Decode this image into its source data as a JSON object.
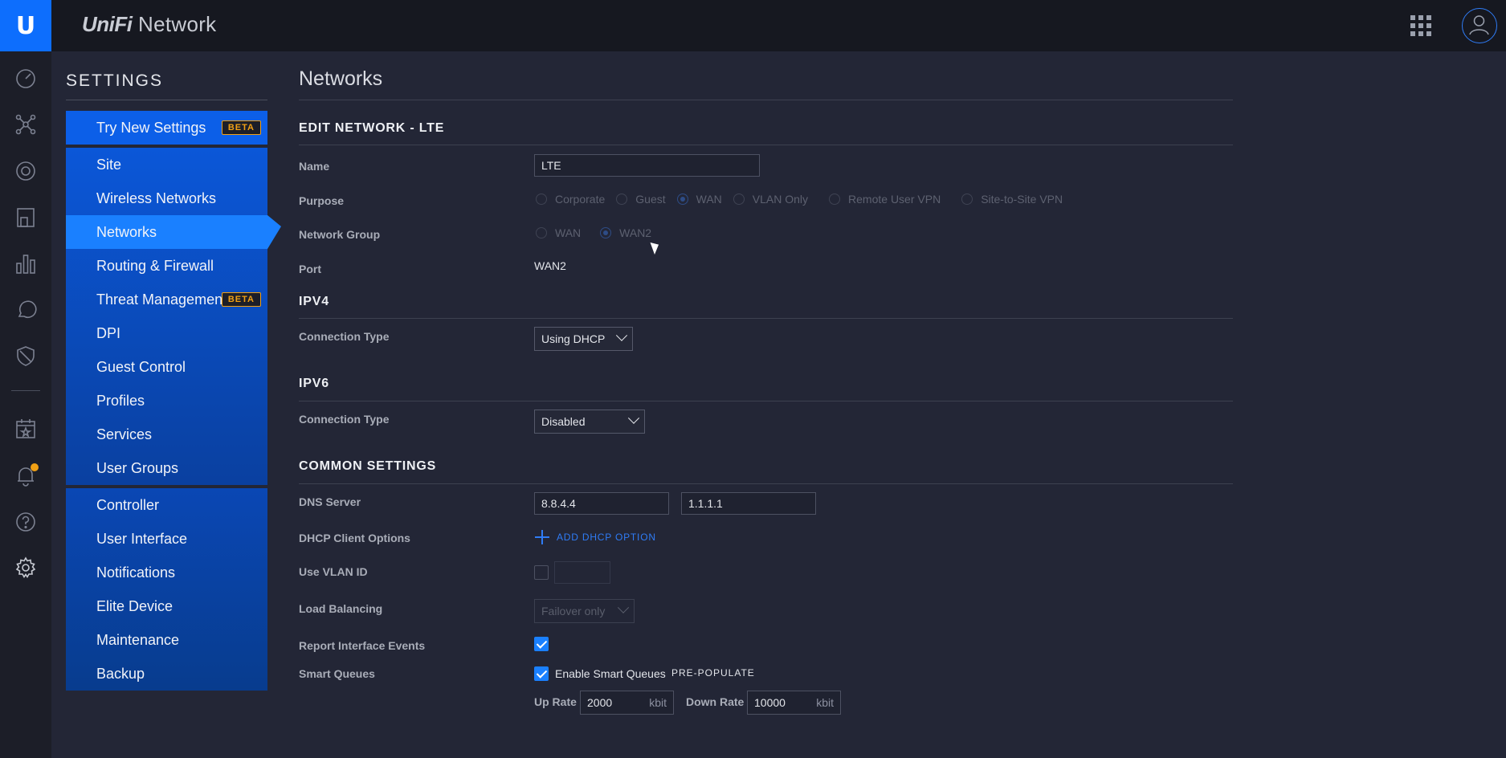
{
  "app": {
    "brand_uni": "UniFi",
    "brand_rest": "Network",
    "logo_letter": "U"
  },
  "settings": {
    "title": "SETTINGS",
    "items": [
      {
        "label": "Try New Settings",
        "badge": "BETA"
      },
      {
        "label": "Site"
      },
      {
        "label": "Wireless Networks"
      },
      {
        "label": "Networks",
        "active": true
      },
      {
        "label": "Routing & Firewall"
      },
      {
        "label": "Threat Management",
        "badge": "BETA"
      },
      {
        "label": "DPI"
      },
      {
        "label": "Guest Control"
      },
      {
        "label": "Profiles"
      },
      {
        "label": "Services"
      },
      {
        "label": "User Groups"
      },
      {
        "label": "Controller"
      },
      {
        "label": "User Interface"
      },
      {
        "label": "Notifications"
      },
      {
        "label": "Elite Device"
      },
      {
        "label": "Maintenance"
      },
      {
        "label": "Backup"
      }
    ]
  },
  "page": {
    "title": "Networks"
  },
  "edit": {
    "section_title": "EDIT NETWORK - LTE",
    "name_label": "Name",
    "name_value": "LTE",
    "purpose_label": "Purpose",
    "purpose_options": [
      "Corporate",
      "Guest",
      "WAN",
      "VLAN Only",
      "Remote User VPN",
      "Site-to-Site VPN"
    ],
    "purpose_selected": "WAN",
    "group_label": "Network Group",
    "group_options": [
      "WAN",
      "WAN2"
    ],
    "group_selected": "WAN2",
    "port_label": "Port",
    "port_value": "WAN2"
  },
  "ipv4": {
    "title": "IPV4",
    "conn_label": "Connection Type",
    "conn_value": "Using DHCP"
  },
  "ipv6": {
    "title": "IPV6",
    "conn_label": "Connection Type",
    "conn_value": "Disabled"
  },
  "common": {
    "title": "COMMON SETTINGS",
    "dns_label": "DNS Server",
    "dns1": "8.8.4.4",
    "dns2": "1.1.1.1",
    "dhcp_label": "DHCP Client Options",
    "add_dhcp": "ADD DHCP OPTION",
    "vlan_label": "Use VLAN ID",
    "vlan_checked": false,
    "lb_label": "Load Balancing",
    "lb_value": "Failover only",
    "report_label": "Report Interface Events",
    "report_checked": true,
    "sq_label": "Smart Queues",
    "sq_checkbox_label": "Enable Smart Queues",
    "sq_checked": true,
    "prepopulate": "PRE-POPULATE",
    "up_label": "Up Rate",
    "up_value": "2000",
    "up_unit": "kbit",
    "down_label": "Down Rate",
    "down_value": "10000",
    "down_unit": "kbit"
  },
  "colors": {
    "accent": "#1a80ff",
    "badge": "#f0a015",
    "background": "#232636"
  }
}
